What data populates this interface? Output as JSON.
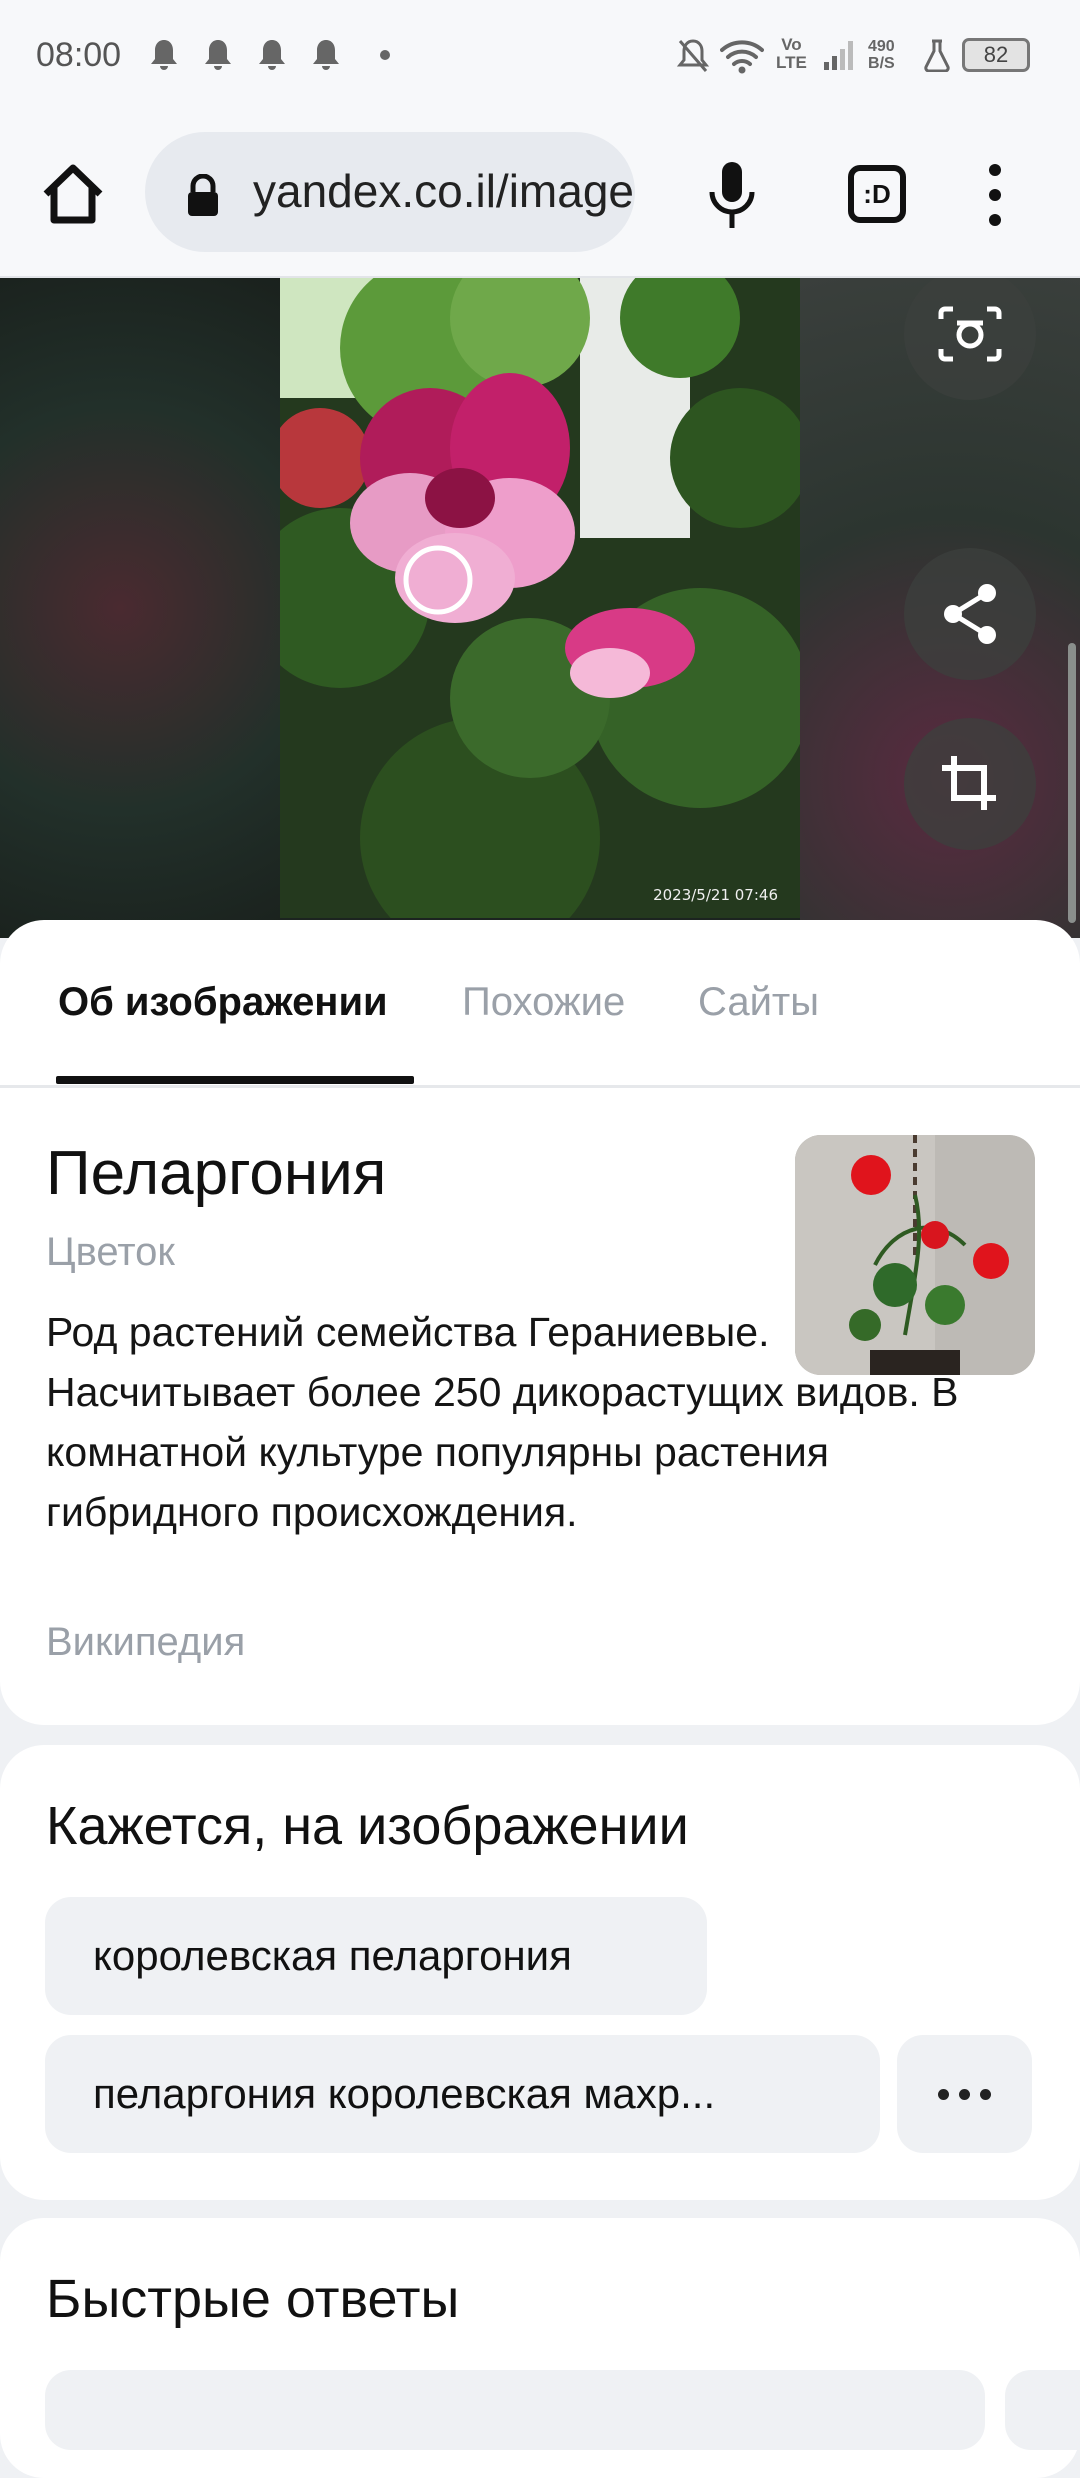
{
  "status_bar": {
    "time": "08:00",
    "network_speed_value": "490",
    "network_speed_unit": "B/S",
    "network_type_top": "Vo",
    "network_type_bottom": "LTE",
    "battery": "82"
  },
  "browser": {
    "url": "yandex.co.il/images",
    "tabs_label": ":D"
  },
  "viewer": {
    "photo_timestamp": "2023/5/21 07:46"
  },
  "tabs": [
    {
      "label": "Об изображении",
      "active": true
    },
    {
      "label": "Похожие",
      "active": false
    },
    {
      "label": "Сайты",
      "active": false
    }
  ],
  "entity": {
    "title": "Пеларгония",
    "subtitle": "Цветок",
    "description": "Род растений семейства Гераниевые. Насчитывает более 250 дикорастущих видов. В комнатной культуре популярны растения гибридного происхождения.",
    "source": "Википедия"
  },
  "seems_section": {
    "title": "Кажется, на изображении",
    "chips": [
      "королевская пеларгония",
      "пеларгония королевская махр..."
    ]
  },
  "quick_answers": {
    "title": "Быстрые ответы"
  },
  "colors": {
    "accent_text": "#111111",
    "muted_text": "#9aa0a8",
    "chip_bg": "#eff1f4"
  }
}
